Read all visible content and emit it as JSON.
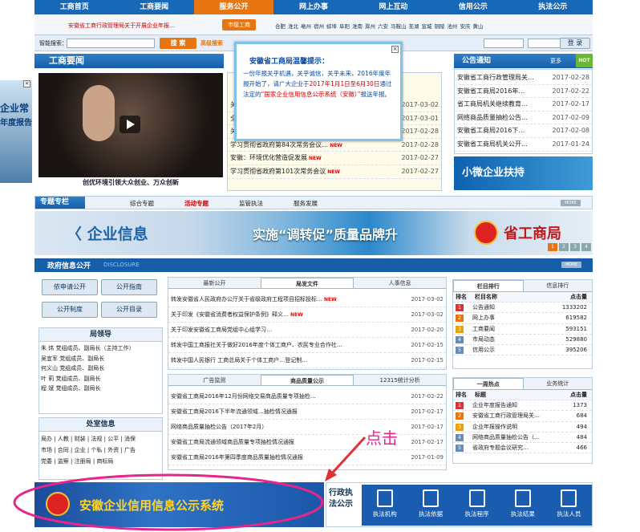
{
  "nav": {
    "items": [
      "工商首页",
      "工商要闻",
      "服务公开",
      "网上办事",
      "网上互动",
      "信用公示",
      "执法公示"
    ],
    "active": 2
  },
  "notice": {
    "text": "安徽省工商行政管理局关于开展企业年报…",
    "city_btn": "市级工商",
    "cities": [
      "合肥",
      "淮北",
      "亳州",
      "宿州",
      "蚌埠",
      "阜阳",
      "淮南",
      "滁州",
      "六安",
      "马鞍山",
      "芜湖",
      "宣城",
      "铜陵",
      "池州",
      "安庆",
      "黄山"
    ]
  },
  "login": {
    "search_label": "智能搜索：",
    "search_btn": "搜  索",
    "adv_search": "高级搜索",
    "login_btn": "登  录"
  },
  "left_ad": {
    "text1": "企业常",
    "text2": "年度报告"
  },
  "news": {
    "title": "工商要闻",
    "caption": "创优环境引领大众创业、万众创新",
    "video_label": "视频"
  },
  "mid_news": {
    "items": [
      {
        "t": "关于合肥市开展2016年度企业年报…",
        "d": "2017-03-02",
        "new": false
      },
      {
        "t": "全省工商和市场监管系统…",
        "d": "2017-03-01",
        "new": false
      },
      {
        "t": "关于开展2017年度…工作的通知",
        "d": "2017-02-28",
        "new": false
      },
      {
        "t": "学习贯彻省政府第84次常务会议…",
        "d": "2017-02-28",
        "new": true
      },
      {
        "t": "安徽：环境优化营造促发展",
        "d": "2017-02-27",
        "new": true
      },
      {
        "t": "学习贯彻省政府第101次常务会议",
        "d": "2017-02-27",
        "new": true
      }
    ]
  },
  "popup": {
    "title": "安徽省工商局温馨提示：",
    "body1": "一份年报关乎机遇，关乎诚信，关乎未来，2016年度年报开始了，请广大企业于",
    "date_range": "2017年1月1日至6月30日",
    "body2": "通过法定的",
    "system": "“国家企业信用信息公示系统（安徽）”",
    "body3": "报送年报。"
  },
  "announce": {
    "title": "公告通知",
    "more": "更多",
    "hot": "HOT",
    "items": [
      {
        "t": "安徽省工商行政管理局关…",
        "d": "2017-02-28"
      },
      {
        "t": "安徽省工商局2016年…",
        "d": "2017-02-22"
      },
      {
        "t": "省工商局机关继续教育…",
        "d": "2017-02-17"
      },
      {
        "t": "网络商品质量抽检公告…",
        "d": "2017-02-09"
      },
      {
        "t": "安徽省工商局2016下…",
        "d": "2017-02-08"
      },
      {
        "t": "安徽省工商局机关公开…",
        "d": "2017-01-24"
      }
    ]
  },
  "small_biz": {
    "label": "小微企业扶持"
  },
  "special": {
    "label": "专题专栏",
    "tabs": [
      "综合专题",
      "活动专题",
      "监管执法",
      "服务发展"
    ],
    "active": 1,
    "more": "MORE"
  },
  "banner": {
    "left": "〈 企业信息",
    "mid": "实施“调转促”质量品牌升",
    "right": "省工商局",
    "pages": [
      "1",
      "2",
      "3",
      "4"
    ]
  },
  "gov": {
    "title": "政府信息公开",
    "subtitle": "DISCLOSURE",
    "more": "MORE"
  },
  "gov_links": [
    [
      "依申请公开",
      "公开指南"
    ],
    [
      "公开制度",
      "公开目录"
    ]
  ],
  "leaders": {
    "title": "局领导",
    "rows": [
      "朱  炜  党组成员、副局长（主持工作）",
      "吴宜军  党组成员、副局长",
      "何义山  党组成员、副局长",
      "叶  莉  党组成员、副局长",
      "程  斌  党组成员、副局长"
    ]
  },
  "depts": {
    "title": "处室信息",
    "rows": [
      "局办 | 人教 | 财装 | 法规 | 公平 | 消保",
      "市场 | 合同 | 企业 | 个私 | 外资 | 广告",
      "党委 | 监察 | 注册局 | 商标局"
    ]
  },
  "tabs1": {
    "tabs": [
      "最新公开",
      "局发文件",
      "人事信息"
    ],
    "active": 1,
    "items": [
      {
        "t": "转发安徽省人民政府办公厅关于省级政府工程项目招标投标…",
        "d": "2017-03-02",
        "new": true
      },
      {
        "t": "关于印发《安徽省消费者权益保护条例》释义…",
        "d": "2017-03-02",
        "new": true
      },
      {
        "t": "关于印发安徽省工商局党组中心组学习…",
        "d": "2017-02-20",
        "new": false
      },
      {
        "t": "转发中国工商报社关于做好2016年度个体工商户、农民专业合作社…",
        "d": "2017-02-15",
        "new": false
      },
      {
        "t": "转发中国人民银行 工商总局关于个体工商户…登记制…",
        "d": "2017-02-15",
        "new": false
      }
    ]
  },
  "tabs2": {
    "tabs": [
      "广告监测",
      "商品质量公示",
      "12315统计分析"
    ],
    "active": 1,
    "items": [
      {
        "t": "安徽省工商局2016年12月份网络交易商品质量专项抽检…",
        "d": "2017-02-22"
      },
      {
        "t": "安徽省工商局2016下半年流通领域…抽检情况通报",
        "d": "2017-02-17"
      },
      {
        "t": "网络商品质量抽检公告（2017年2月）",
        "d": "2017-02-17"
      },
      {
        "t": "安徽省工商局流通领域商品质量专项抽检情况通报",
        "d": "2017-02-17"
      },
      {
        "t": "安徽省工商局2016年第四季度商品质量抽检情况通报",
        "d": "2017-01-09"
      }
    ]
  },
  "column_rank": {
    "tabs": [
      "栏目排行",
      "信息排行"
    ],
    "active": 0,
    "head": [
      "排名",
      "栏目名称",
      "点击量"
    ],
    "rows": [
      {
        "n": "1",
        "name": "公告通知",
        "v": "1333202"
      },
      {
        "n": "2",
        "name": "网上办事",
        "v": "619582"
      },
      {
        "n": "3",
        "name": "工商要闻",
        "v": "593151"
      },
      {
        "n": "4",
        "name": "市局动态",
        "v": "529880"
      },
      {
        "n": "5",
        "name": "信用公示",
        "v": "395206"
      }
    ]
  },
  "hot_rank": {
    "tabs": [
      "一周热点",
      "业务统计"
    ],
    "active": 0,
    "head": [
      "排名",
      "标题",
      "点击量"
    ],
    "rows": [
      {
        "n": "1",
        "name": "企业年度报告通知",
        "v": "1373"
      },
      {
        "n": "2",
        "name": "安徽省工商行政管理局关…",
        "v": "684"
      },
      {
        "n": "3",
        "name": "企业年报操作说明",
        "v": "494"
      },
      {
        "n": "4",
        "name": "网络商品质量抽检公告（…",
        "v": "484"
      },
      {
        "n": "5",
        "name": "省政府专题会议研究…",
        "v": "466"
      }
    ]
  },
  "credit": {
    "label": "安徽企业信用信息公示系统"
  },
  "law": {
    "label": "行政执法公示",
    "items": [
      "执法机构",
      "执法依据",
      "执法程序",
      "执法结果",
      "执法人员"
    ]
  },
  "annotation": {
    "text": "点击"
  },
  "colors": {
    "nav": "#1868b8",
    "accent": "#e67512",
    "annotation": "#e8258a"
  }
}
